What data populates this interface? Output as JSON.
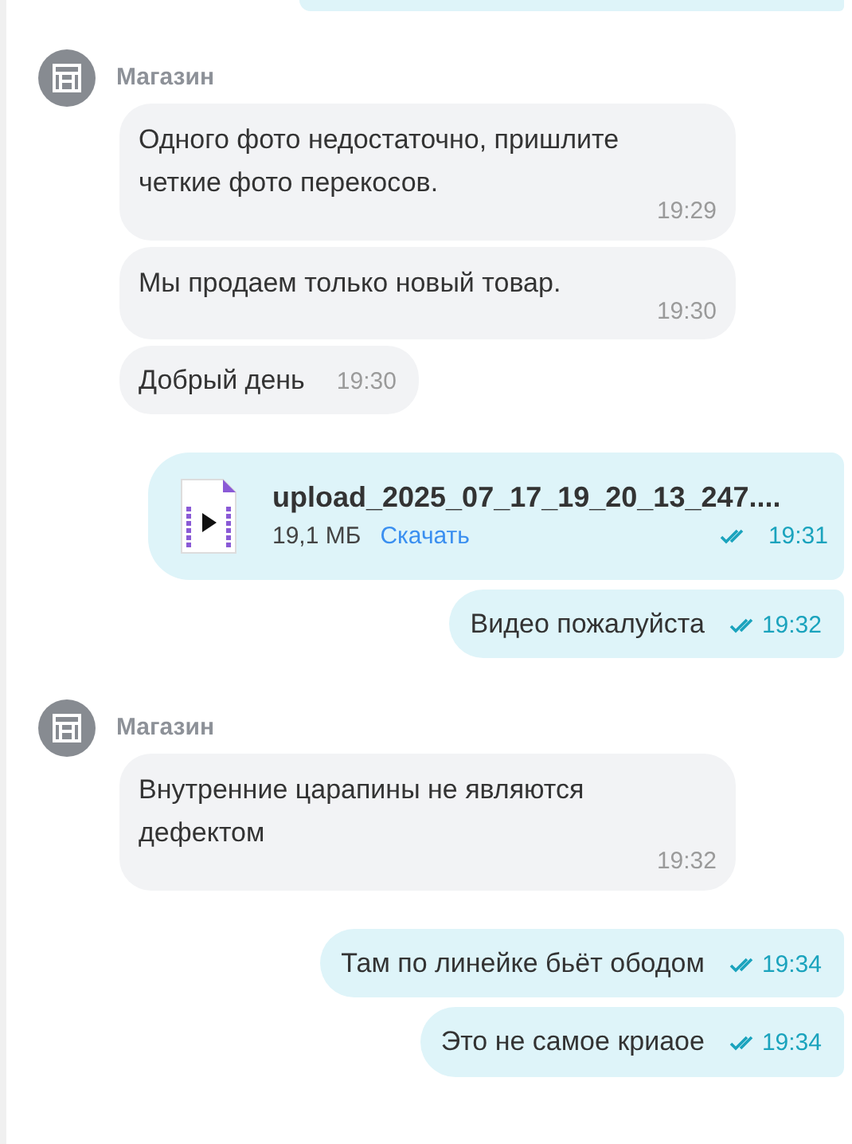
{
  "blocks": [
    {
      "kind": "partial"
    },
    {
      "kind": "incoming",
      "sender": "Магазин",
      "messages": [
        {
          "text": "Одного фото недостаточно, пришлите четкие фото перекосов.",
          "time": "19:29",
          "kind": "stacked"
        },
        {
          "text": "Мы продаем только новый товар.",
          "time": "19:30",
          "kind": "stacked"
        },
        {
          "text": "Добрый день",
          "time": "19:30",
          "kind": "inline"
        }
      ]
    },
    {
      "kind": "outgoing",
      "messages": [
        {
          "kind": "file",
          "file_name": "upload_2025_07_17_19_20_13_247....",
          "size": "19,1 МБ",
          "action": "Скачать",
          "time": "19:31",
          "read": true
        },
        {
          "kind": "text",
          "text": "Видео пожалуйста",
          "time": "19:32",
          "read": true
        }
      ]
    },
    {
      "kind": "incoming",
      "sender": "Магазин",
      "messages": [
        {
          "text": "Внутренние царапины не являются дефектом",
          "time": "19:32",
          "kind": "stacked"
        }
      ]
    },
    {
      "kind": "outgoing",
      "messages": [
        {
          "kind": "text",
          "text": "Там по линейке бьёт ободом",
          "time": "19:34",
          "read": true
        },
        {
          "kind": "text",
          "text": "Это не самое криаое",
          "time": "19:34",
          "read": true
        }
      ]
    }
  ]
}
